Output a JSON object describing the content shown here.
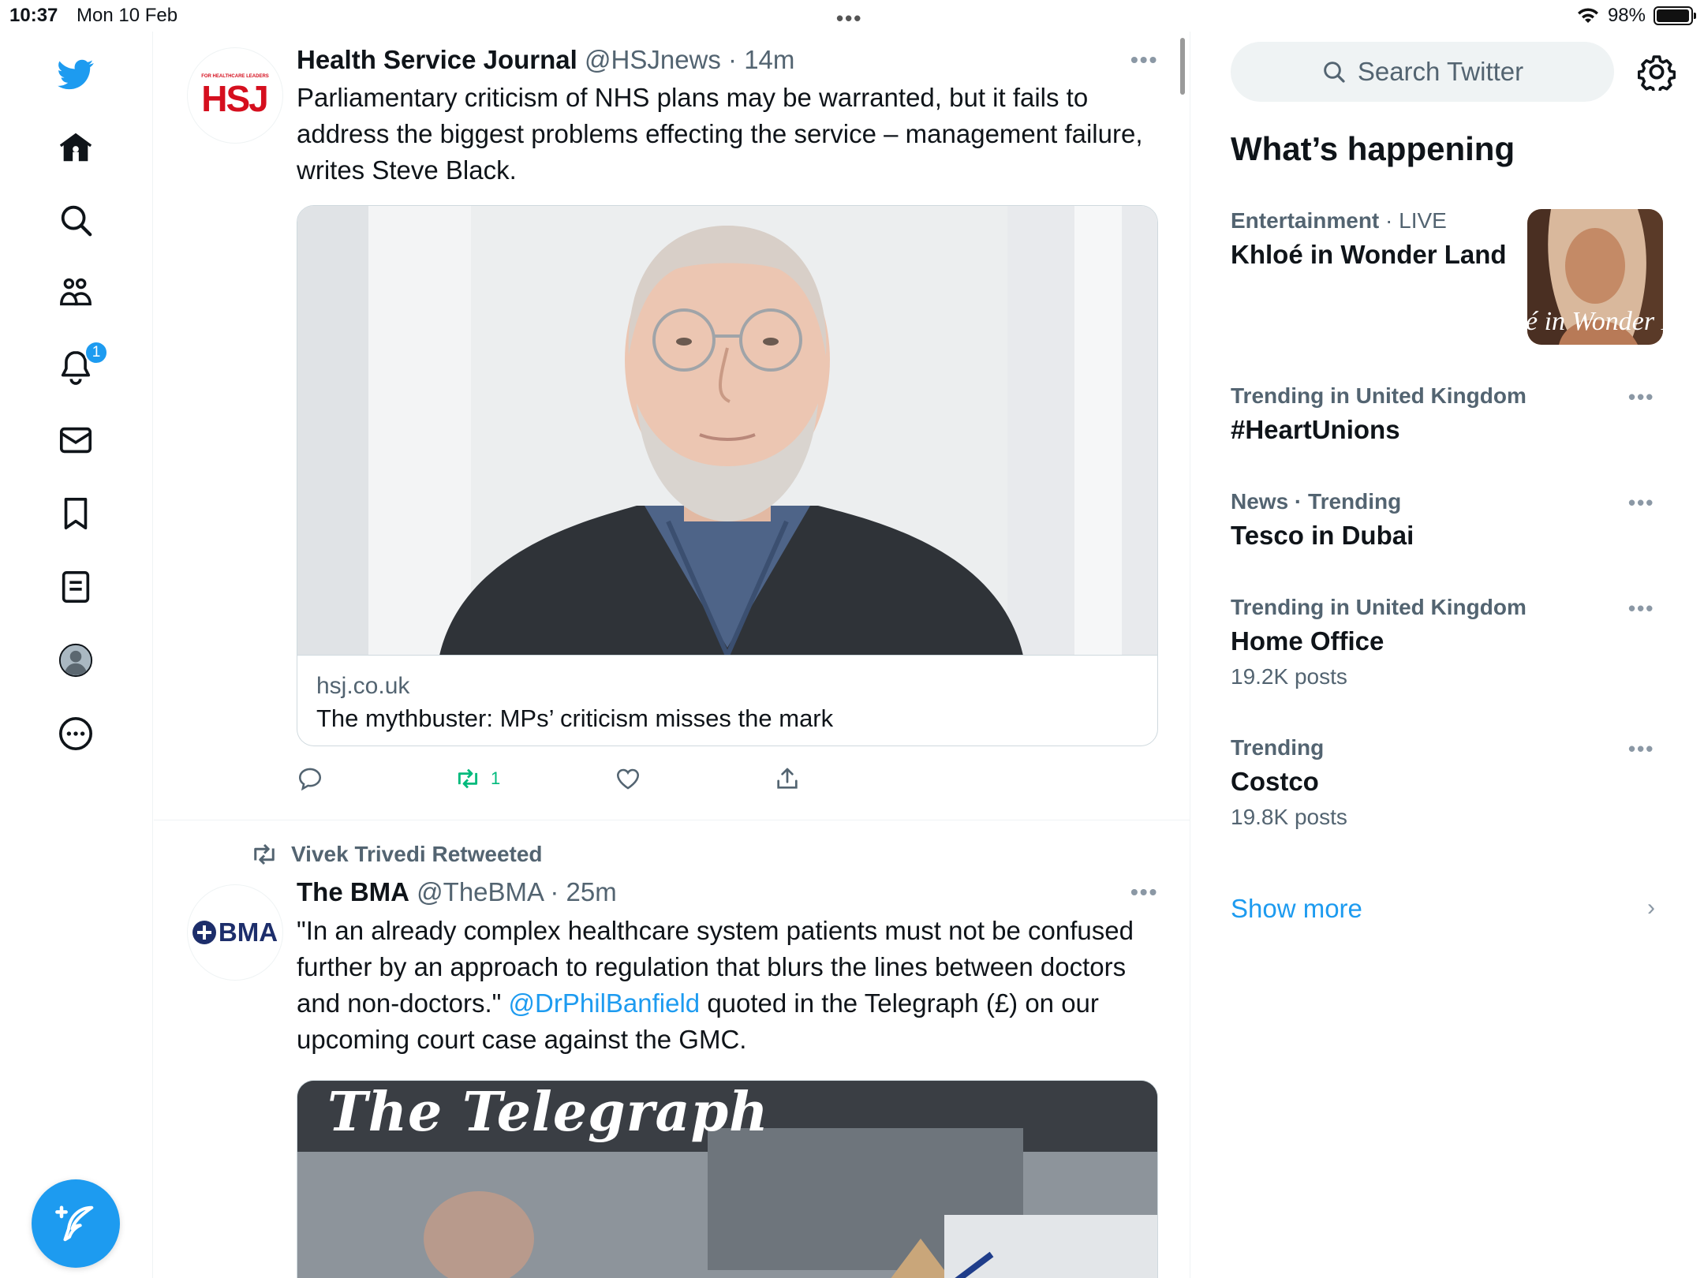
{
  "status_bar": {
    "time": "10:37",
    "date": "Mon 10 Feb",
    "battery_text": "98%",
    "battery_level": 0.98
  },
  "nav": {
    "notifications_badge": "1",
    "accent_color": "#1d9bf0"
  },
  "tweets": [
    {
      "name": "Health Service Journal",
      "meta": "@HSJnews · 14m",
      "avatar_text": "HSJ",
      "avatar_small_text": "FOR HEALTHCARE LEADERS",
      "text": "Parliamentary criticism of NHS plans may be warranted, but it fails to address the biggest problems effecting the service – management failure, writes Steve Black.",
      "card": {
        "domain": "hsj.co.uk",
        "title": "The mythbuster: MPs’ criticism misses the mark"
      },
      "retweet_count": "1"
    },
    {
      "retweeted_by": "Vivek Trivedi Retweeted",
      "name": "The BMA",
      "meta": "@TheBMA · 25m",
      "avatar_text": "BMA",
      "text_before": "\"In an already complex healthcare system patients must not be confused further by an approach to regulation that blurs the lines between doctors and non-doctors.\" ",
      "mention": "@DrPhilBanfield",
      "text_after": " quoted in the Telegraph (£) on our upcoming court case against the GMC.",
      "media_title": "The Telegraph"
    }
  ],
  "sidebar": {
    "search_placeholder": "Search Twitter",
    "whats_happening": "What’s happening",
    "trends": [
      {
        "category": "Entertainment",
        "live": " · LIVE",
        "name": "Khloé in Wonder Land",
        "thumb_text": "é in Wonder I"
      },
      {
        "category": "Trending in United Kingdom",
        "name": "#HeartUnions"
      },
      {
        "category": "News · Trending",
        "name": "Tesco in Dubai"
      },
      {
        "category": "Trending in United Kingdom",
        "name": "Home Office",
        "count": "19.2K posts"
      },
      {
        "category": "Trending",
        "name": "Costco",
        "count": "19.8K posts"
      }
    ],
    "show_more": "Show more"
  }
}
